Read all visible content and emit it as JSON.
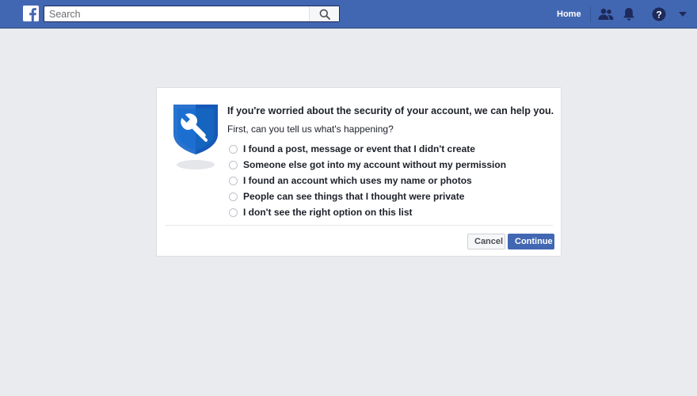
{
  "topbar": {
    "search_placeholder": "Search",
    "home_label": "Home",
    "icons": {
      "logo": "facebook-logo-icon",
      "search": "search-icon",
      "friends": "friend-requests-icon",
      "notifications": "bell-icon",
      "help": "help-question-icon",
      "menu": "caret-down-icon"
    }
  },
  "dialog": {
    "title": "If you're worried about the security of your account, we can help you.",
    "subtitle": "First, can you tell us what's happening?",
    "icon": "shield-wrench-icon",
    "options": [
      {
        "label": "I found a post, message or event that I didn't create",
        "selected": false
      },
      {
        "label": "Someone else got into my account without my permission",
        "selected": false
      },
      {
        "label": "I found an account which uses my name or photos",
        "selected": false
      },
      {
        "label": "People can see things that I thought were private",
        "selected": false
      },
      {
        "label": "I don't see the right option on this list",
        "selected": false
      }
    ],
    "cancel_label": "Cancel",
    "continue_label": "Continue"
  },
  "colors": {
    "brand": "#4267b2",
    "page_background": "#e9ebee",
    "shield_blue": "#1565c0",
    "text": "#1d2129"
  }
}
